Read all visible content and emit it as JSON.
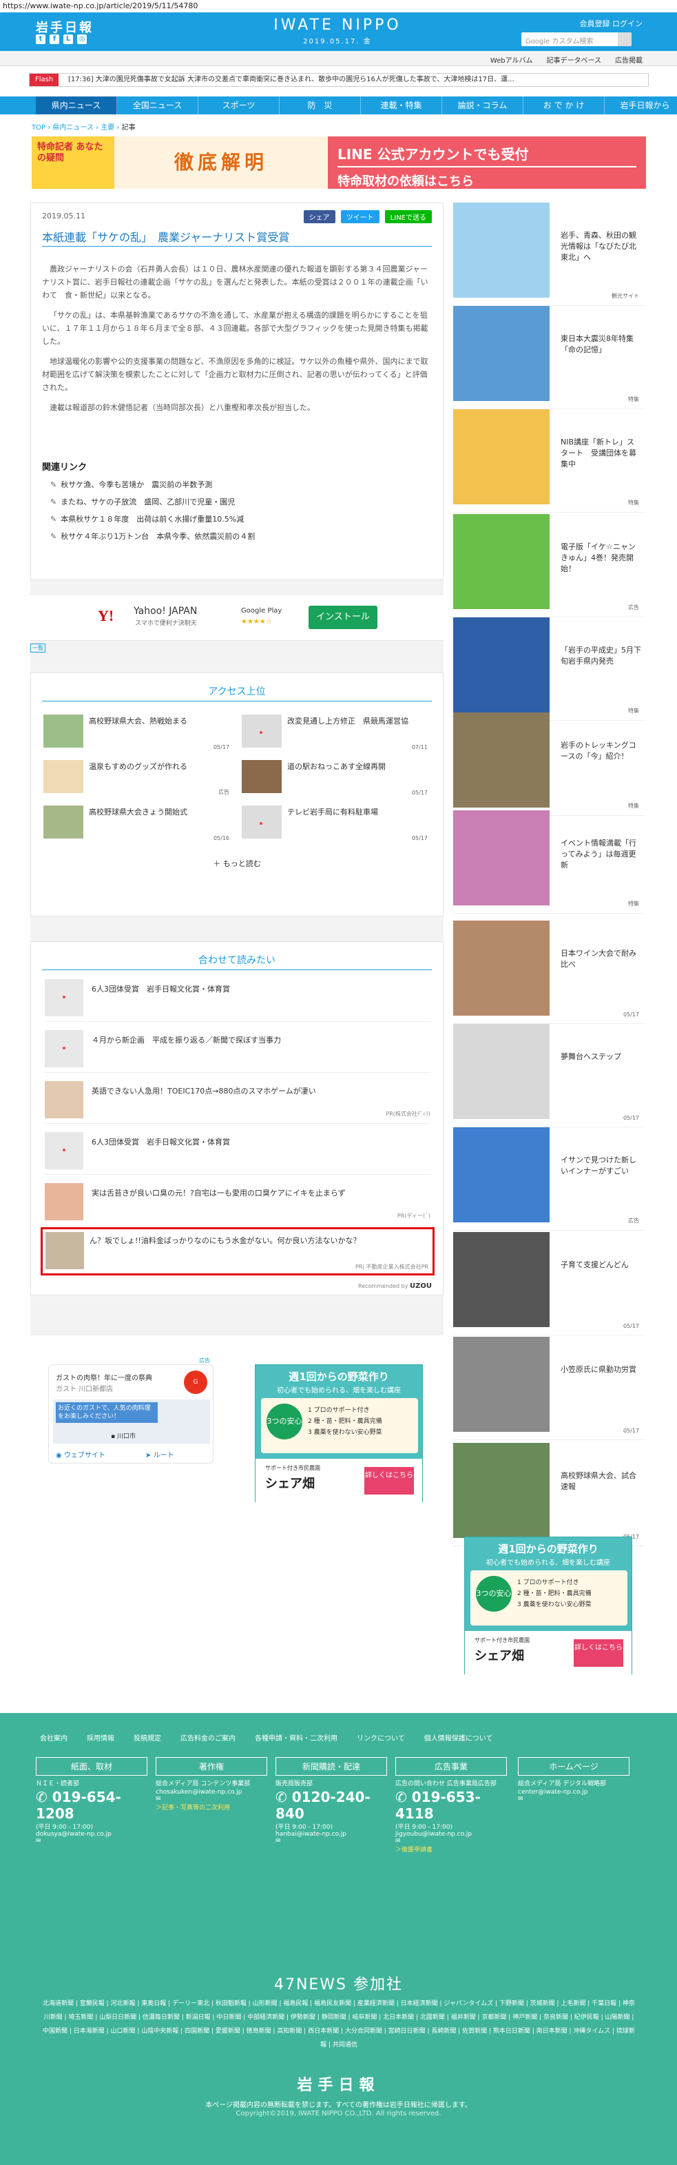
{
  "url": "https://www.iwate-np.co.jp/article/2019/5/11/54780",
  "header": {
    "logo": "岩手日報",
    "brand": "IWATE NIPPO",
    "date": "2019.05.17. 金",
    "links": "会員登録  ログイン",
    "search_placeholder": "Google カスタム検索"
  },
  "subnav": [
    "Webアルバム",
    "記事データベース",
    "広告掲載"
  ],
  "flash": {
    "label": "Flash",
    "text": "[17:36] 大津の園児死傷事故で女起訴  大津市の交差点で車両衝突に巻き込まれ、散歩中の園児ら16人が死傷した事故で、大津地検は17日、運..."
  },
  "gnav": [
    "県内ニュース",
    "全国ニュース",
    "スポーツ",
    "防　災",
    "連載・特集",
    "論説・コラム",
    "お で か け",
    "岩手日報から"
  ],
  "breadcrumb": {
    "top": "TOP",
    "a": "県内ニュース",
    "b": "主要",
    "c": "記事"
  },
  "banner": {
    "left": "特命記者 あなたの疑問",
    "middle": "徹底解明",
    "right_top": "LINE 公式アカウントでも受付",
    "right_bottom": "特命取材の依頼はこちら"
  },
  "article": {
    "date": "2019.05.11",
    "share": [
      "シェア",
      "ツイート",
      "LINEで送る"
    ],
    "title": "本紙連載「サケの乱」　農業ジャーナリスト賞受賞",
    "paragraphs": [
      "農政ジャーナリストの会（石井勇人会長）は１０日、農林水産関連の優れた報道を顕彰する第３４回農業ジャーナリスト賞に、岩手日報社の連載企画「サケの乱」を選んだと発表した。本紙の受賞は２００１年の連載企画「いわて　食・新世紀」以来となる。",
      "「サケの乱」は、本県基幹漁業であるサケの不漁を通して、水産業が抱える構造的課題を明らかにすることを狙いに、１７年１１月から１８年６月まで全８部、４３回連載。各部で大型グラフィックを使った見開き特集も掲載した。",
      "地球温暖化の影響や公的支援事業の問題など、不漁原因を多角的に検証。サケ以外の魚種や県外、国内にまで取材範囲を広げて解決策を模索したことに対して「企画力と取材力に圧倒され、記者の思いが伝わってくる」と評価された。",
      "連載は報道部の鈴木健悟記者（当時同部次長）と八重樫和孝次長が担当した。"
    ],
    "related_heading": "関連リンク",
    "related": [
      "秋サケ漁、今季も苦境か　震災前の半数予測",
      "またね、サケの子放流　盛岡、乙部川で児童・園児",
      "本県秋サケ１８年度　出荷は前く水揚げ重量10.5%減",
      "秋サケ４年ぶり1万トン台　本県今季、依然震災前の４割"
    ]
  },
  "app_ad": {
    "brand": "Y!",
    "title": "Yahoo! JAPAN",
    "sub": "スマホで便利ナ決制天",
    "store": "Google Play",
    "stars": "★★★★☆",
    "install": "インストール",
    "tag": "一覧"
  },
  "ranking": {
    "title": "アクセス上位",
    "items": [
      {
        "title": "高校野球県大会、熱戦始まる",
        "date": "05/17"
      },
      {
        "title": "改変見通し上方修正　県競馬運営協",
        "date": "07/11"
      },
      {
        "title": "温泉もすめのグッズが作れる",
        "date": "広告"
      },
      {
        "title": "道の駅おねっこあす全線再開",
        "date": "05/17"
      },
      {
        "title": "高校野球県大会きょう開始式",
        "date": "05/16"
      },
      {
        "title": "テレビ岩手局に有料駐車場",
        "date": "05/17"
      }
    ],
    "more": "もっと読む"
  },
  "also_read": {
    "title": "合わせて読みたい",
    "items": [
      {
        "title": "6人3団体受賞　岩手日報文化賞・体育賞",
        "pr": ""
      },
      {
        "title": "４月から新企画　平成を振り返る／新聞で探ぼす当事力",
        "pr": ""
      },
      {
        "title": "英語できない人急用！TOEIC170点→880点のスマホゲームが凄い",
        "pr": "PR(株式会社ﾃﾞｨﾗ)"
      },
      {
        "title": "6人3団体受賞　岩手日報文化賞・体育賞",
        "pr": ""
      },
      {
        "title": "実は舌苔きが良い口臭の元！?自宅は一も愛用の口臭ケアにイキを止まらず",
        "pr": "PR(ディーﾋﾟ)"
      },
      {
        "title": "ん？坂でしょ!!油料金ばっかりなのにもう水金がない。何か良い方法ないかな？",
        "pr": "PR| 不動産企業入株式会社PR"
      }
    ],
    "credit": "Recommended by",
    "credit_brand": "UZOU"
  },
  "lower_ads": {
    "tag": "広告",
    "map_title": "ガストの肉祭！年に一度の祭典",
    "map_sub": "ガスト 川口新都店",
    "map_msg": "お近くのガストで、人気の肉料理をお楽しみください！",
    "map_place": "川口市",
    "web": "ウェブサイト",
    "route": "ルート"
  },
  "veg_ad": {
    "title": "週1回からの野菜作り",
    "sub": "初心者でも始められる、畑を楽しむ講座",
    "badge": "3つの安心",
    "items": [
      "1 プロのサポート付き",
      "2 種・苗・肥料・農具完備",
      "3 農薬を使わない安心野菜"
    ],
    "footer_a": "サポート付き市民農園",
    "footer_b": "シェア畑",
    "cta": "詳しくはこちら"
  },
  "sidebar": [
    {
      "title": "岩手、青森、秋田の観光情報は「なびたび北東北」へ",
      "tag": "観光サイト",
      "color": "#9fd2f0"
    },
    {
      "title": "東日本大震災8年特集「命の記憶」",
      "tag": "特集",
      "color": "#5b9bd5"
    },
    {
      "title": "NIB講座「新トレ」スタート　受講団体を募集中",
      "tag": "特集",
      "color": "#f2c14e"
    },
    {
      "title": "電子版「イケ☆ニャンきゅん」4巻！発売開始！",
      "tag": "広告",
      "color": "#6abf4b"
    },
    {
      "title": "「岩手の平成史」5月下旬岩手県内発売",
      "tag": "特集",
      "color": "#2e5fa8"
    },
    {
      "title": "岩手のトレッキングコースの「今」紹介！",
      "tag": "特集",
      "color": "#8a7a5a"
    },
    {
      "title": "イベント情報満載「行ってみよう」は毎週更新",
      "tag": "特集",
      "color": "#c97fb4"
    },
    {
      "title": "日本ワイン大会で耐み比べ",
      "tag": "05/17",
      "color": "#b58a6a"
    },
    {
      "title": "夢舞台へステップ",
      "tag": "05/17",
      "color": "#d8d8d8"
    },
    {
      "title": "イサンで見つけた新しいインナーがすごい",
      "tag": "広告",
      "color": "#3f7fd0"
    },
    {
      "title": "子育て支援どんどん",
      "tag": "05/17",
      "color": "#555555"
    },
    {
      "title": "小笠原氏に県勤功労賞",
      "tag": "05/17",
      "color": "#8a8a8a"
    },
    {
      "title": "高校野球県大会、試合速報",
      "tag": "05/17",
      "color": "#6a8a5a"
    }
  ],
  "footer": {
    "links": [
      "会社案内",
      "採用情報",
      "投稿規定",
      "広告料金のご案内",
      "各種申請・資料・二次利用",
      "リンクについて",
      "個人情報保護について"
    ],
    "cols": [
      {
        "head": "紙面、取材",
        "text": "ＮＩＥ・読者部",
        "phone": "019-654-1208",
        "hours": "(平日 9:00 - 17:00)",
        "mail": "dokusya@iwate-np.co.jp",
        "extra": ""
      },
      {
        "head": "著作権",
        "text": "総合メディア局 コンテンツ事業部",
        "phone": "",
        "hours": "",
        "mail": "chosakuken@iwate-np.co.jp",
        "extra": "＞記事・写真等の二次利用"
      },
      {
        "head": "新聞購読・配達",
        "text": "販売局販売部",
        "phone": "0120-240-840",
        "hours": "(平日 9:00 - 17:00)",
        "mail": "hanbai@iwate-np.co.jp",
        "extra": ""
      },
      {
        "head": "広告事業",
        "text": "広告の問い合わせ 広告事業局広告部",
        "phone": "019-653-4118",
        "hours": "(平日 9:00 - 17:00)",
        "mail": "jigyoubu@iwate-np.co.jp",
        "extra": "＞後援申請書"
      },
      {
        "head": "ホームページ",
        "text": "総合メディア局 デジタル戦略部",
        "phone": "",
        "hours": "",
        "mail": "center@iwate-np.co.jp",
        "extra": ""
      }
    ],
    "net_title": "47NEWS 参加社",
    "papers": "北海道新聞 | 室蘭民報 | 河北新報 | 東奥日報 | デーリー東北 | 秋田魁新報 | 山形新聞 | 福島民報 | 福島民友新聞 | 産業経済新聞 | 日本経済新聞 | ジャパンタイムズ | 下野新聞 | 茨城新聞 | 上毛新聞 | 千葉日報 | 神奈川新聞 | 埼玉新聞 | 山梨日日新聞 | 信濃毎日新聞 | 新潟日報 | 中日新聞 | 中部経済新聞 | 伊勢新聞 | 静岡新聞 | 岐阜新聞 | 北日本新聞 | 北國新聞 | 福井新聞 | 京都新聞 | 神戸新聞 | 奈良新聞 | 紀伊民報 | 山陽新聞 | 中国新聞 | 日本海新聞 | 山口新聞 | 山陰中央新報 | 四国新聞 | 愛媛新聞 | 徳島新聞 | 高知新聞 | 西日本新聞 | 大分合同新聞 | 宮崎日日新聞 | 長崎新聞 | 佐賀新聞 | 熊本日日新聞 | 南日本新聞 | 沖縄タイムス | 琉球新報 | 共同通信",
    "logo": "岩手日報",
    "note": "本ページ掲載内容の無断転載を禁じます。すべての著作権は岩手日報社に帰属します。",
    "copy": "Copyright©2019, IWATE NIPPO CO.,LTD. All rights reserved."
  }
}
